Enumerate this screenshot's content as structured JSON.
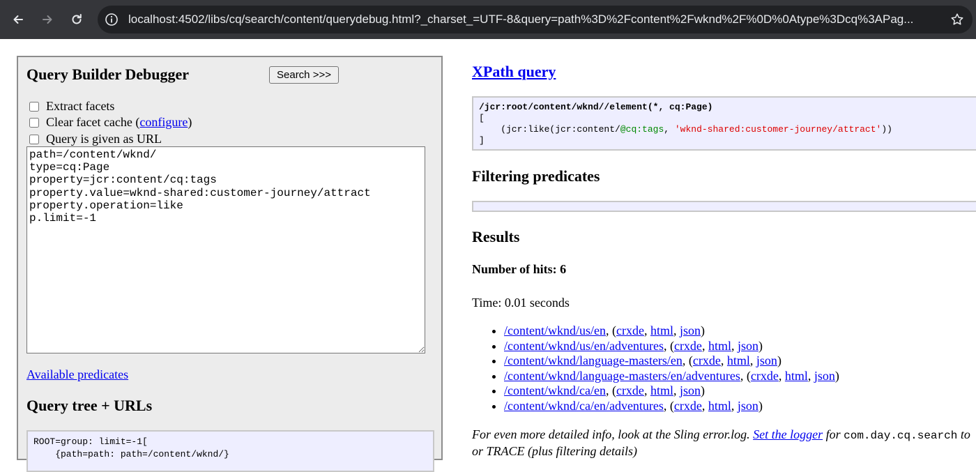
{
  "browser": {
    "url": "localhost:4502/libs/cq/search/content/querydebug.html?_charset_=UTF-8&query=path%3D%2Fcontent%2Fwknd%2F%0D%0Atype%3Dcq%3APag..."
  },
  "left": {
    "title": "Query Builder Debugger",
    "search_button": "Search >>>",
    "checks": {
      "extract_facets": "Extract facets",
      "clear_cache_pre": "Clear facet cache (",
      "clear_cache_link": "configure",
      "clear_cache_post": ")",
      "url_query": "Query is given as URL"
    },
    "query_text": "path=/content/wknd/\ntype=cq:Page\nproperty=jcr:content/cq:tags\nproperty.value=wknd-shared:customer-journey/attract\nproperty.operation=like\np.limit=-1",
    "available_predicates": "Available predicates",
    "query_tree_title": "Query tree + URLs",
    "query_tree_line1": "ROOT=group: limit=-1[",
    "query_tree_line2": "    {path=path: path=/content/wknd/}"
  },
  "right": {
    "xpath_title": "XPath query",
    "xpath_main": "/jcr:root/content/wknd//element(*, cq:Page)",
    "xpath_open": "[",
    "xpath_like_pre": "    (jcr:like(jcr:content/",
    "xpath_attr": "@cq:tags",
    "xpath_comma": ", ",
    "xpath_str": "'wknd-shared:customer-journey/attract'",
    "xpath_like_post": "))",
    "xpath_close": "]",
    "filtering_title": "Filtering predicates",
    "results_title": "Results",
    "hits": "Number of hits: 6",
    "time": "Time: 0.01 seconds",
    "results": [
      {
        "path": "/content/wknd/us/en",
        "crxde": "crxde",
        "html": "html",
        "json": "json"
      },
      {
        "path": "/content/wknd/us/en/adventures",
        "crxde": "crxde",
        "html": "html",
        "json": "json"
      },
      {
        "path": "/content/wknd/language-masters/en",
        "crxde": "crxde",
        "html": "html",
        "json": "json"
      },
      {
        "path": "/content/wknd/language-masters/en/adventures",
        "crxde": "crxde",
        "html": "html",
        "json": "json"
      },
      {
        "path": "/content/wknd/ca/en",
        "crxde": "crxde",
        "html": "html",
        "json": "json"
      },
      {
        "path": "/content/wknd/ca/en/adventures",
        "crxde": "crxde",
        "html": "html",
        "json": "json"
      }
    ],
    "info_pre": "For even more detailed info, look at the Sling error.log. ",
    "info_link": "Set the logger",
    "info_mid": " for ",
    "info_code": "com.day.cq.search",
    "info_post": " to",
    "info_line2": "or TRACE (plus filtering details)"
  }
}
